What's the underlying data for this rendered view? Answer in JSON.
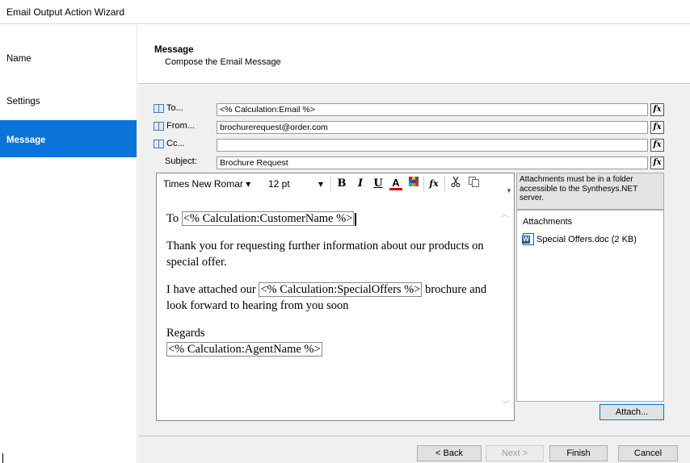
{
  "window": {
    "title": "Email Output Action Wizard"
  },
  "nav": {
    "items": [
      {
        "label": "Name"
      },
      {
        "label": "Settings"
      },
      {
        "label": "Message"
      }
    ]
  },
  "header": {
    "title": "Message",
    "subtitle": "Compose the Email Message"
  },
  "fields": {
    "to": {
      "label": "To...",
      "value": "<% Calculation:Email %>"
    },
    "from": {
      "label": "From...",
      "value": "brochurerequest@order.com"
    },
    "cc": {
      "label": "Cc...",
      "value": ""
    },
    "subject": {
      "label": "Subject:",
      "value": "Brochure Request"
    },
    "fx_label": "fx"
  },
  "editor": {
    "font": "Times New Romar",
    "size": "12 pt",
    "dropdown_arrow": "▾",
    "toolbar_icons": [
      "bold-icon",
      "italic-icon",
      "underline-icon",
      "font-color-icon",
      "highlight-icon",
      "function-icon",
      "cut-icon",
      "copy-icon"
    ],
    "buttons": {
      "bold": "B",
      "italic": "I",
      "underline": "U",
      "color": "A",
      "fx": "fx"
    },
    "body": {
      "line1_prefix": "To ",
      "line1_placeholder": "<% Calculation:CustomerName %>",
      "para2": "Thank you for requesting further information about our products on special offer.",
      "para3_prefix": "I have attached our ",
      "para3_placeholder": "<% Calculation:SpecialOffers %>",
      "para3_suffix": " brochure and look forward to hearing from you soon",
      "regards": "Regards",
      "agent_placeholder": "<% Calculation:AgentName %>"
    }
  },
  "attachments": {
    "note": "Attachments must be in a folder accessible to the Synthesys.NET server.",
    "header": "Attachments",
    "items": [
      {
        "name": "Special Offers.doc (2 KB)"
      }
    ],
    "attach_button": "Attach..."
  },
  "footer": {
    "back": "< Back",
    "next": "Next >",
    "finish": "Finish",
    "cancel": "Cancel"
  },
  "colors": {
    "accent": "#0a74da"
  }
}
